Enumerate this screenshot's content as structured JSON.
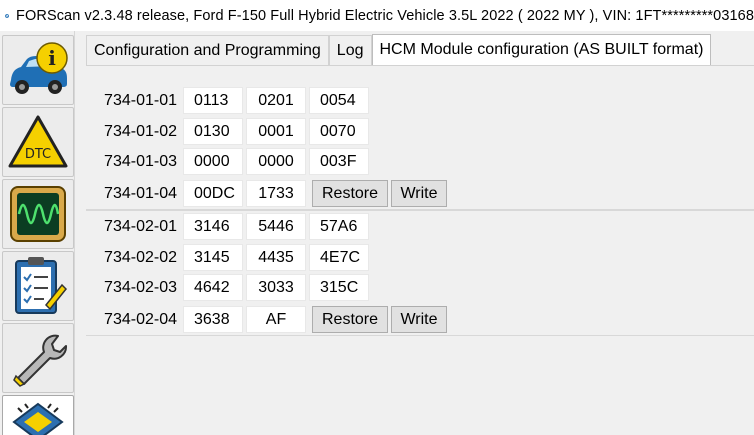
{
  "window": {
    "title": "FORScan v2.3.48 release, Ford F-150 Full Hybrid Electric Vehicle 3.5L 2022 ( 2022 MY ), VIN: 1FT*********03168"
  },
  "sidebar": {
    "items": [
      {
        "name": "vehicle-info",
        "glyph": "i"
      },
      {
        "name": "dtc",
        "glyph": "DTC"
      },
      {
        "name": "oscilloscope"
      },
      {
        "name": "checklist"
      },
      {
        "name": "service-wrench"
      },
      {
        "name": "configuration-chip"
      }
    ]
  },
  "tabs": [
    {
      "label": "Configuration and Programming"
    },
    {
      "label": "Log"
    },
    {
      "label": "HCM Module configuration (AS BUILT format)"
    }
  ],
  "block1": {
    "rows": [
      {
        "label": "734-01-01",
        "v1": "0113",
        "v2": "0201",
        "v3": "0054"
      },
      {
        "label": "734-01-02",
        "v1": "0130",
        "v2": "0001",
        "v3": "0070"
      },
      {
        "label": "734-01-03",
        "v1": "0000",
        "v2": "0000",
        "v3": "003F"
      },
      {
        "label": "734-01-04",
        "v1": "00DC",
        "v2": "1733",
        "restore": "Restore",
        "write": "Write"
      }
    ]
  },
  "block2": {
    "rows": [
      {
        "label": "734-02-01",
        "v1": "3146",
        "v2": "5446",
        "v3": "57A6"
      },
      {
        "label": "734-02-02",
        "v1": "3145",
        "v2": "4435",
        "v3": "4E7C"
      },
      {
        "label": "734-02-03",
        "v1": "4642",
        "v2": "3033",
        "v3": "315C"
      },
      {
        "label": "734-02-04",
        "v1": "3638",
        "v2": "AF",
        "restore": "Restore",
        "write": "Write"
      }
    ]
  },
  "colors": {
    "accent_yellow": "#f5d000",
    "car_blue": "#1f6fb5",
    "scope_green": "#2bb64a",
    "tab_active_bg": "#ffffff"
  }
}
